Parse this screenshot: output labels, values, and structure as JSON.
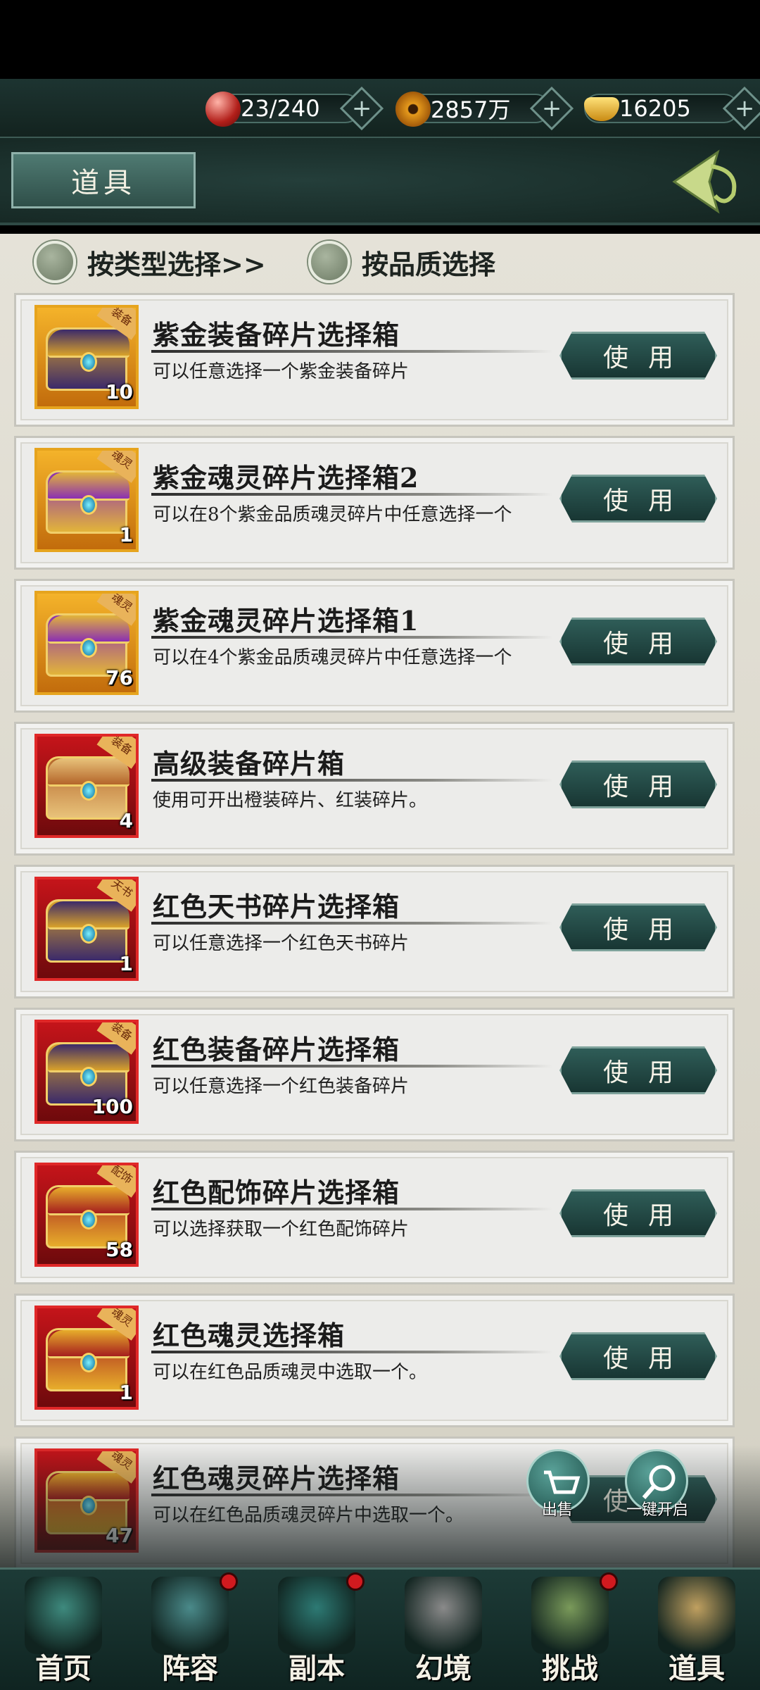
{
  "resources": [
    {
      "name": "stamina",
      "value": "23/240",
      "color": "#c0392b"
    },
    {
      "name": "coins",
      "value": "2857万",
      "color": "#d78a15"
    },
    {
      "name": "ingots",
      "value": "16205",
      "color": "#e7b325"
    }
  ],
  "header": {
    "title": "道具"
  },
  "filters": {
    "by_type": "按类型选择>>",
    "by_quality": "按品质选择"
  },
  "items": [
    {
      "name": "紫金装备碎片选择箱",
      "desc": "可以任意选择一个紫金装备碎片",
      "qty": "10",
      "frame": "gold",
      "chest": "gold",
      "tag": "装备",
      "button": "使用"
    },
    {
      "name": "紫金魂灵碎片选择箱2",
      "desc": "可以在8个紫金品质魂灵碎片中任意选择一个",
      "qty": "1",
      "frame": "gold",
      "chest": "purple",
      "tag": "魂灵",
      "button": "使用"
    },
    {
      "name": "紫金魂灵碎片选择箱1",
      "desc": "可以在4个紫金品质魂灵碎片中任意选择一个",
      "qty": "76",
      "frame": "gold",
      "chest": "purple",
      "tag": "魂灵",
      "button": "使用"
    },
    {
      "name": "高级装备碎片箱",
      "desc": "使用可开出橙装碎片、红装碎片。",
      "qty": "4",
      "frame": "red",
      "chest": "brown",
      "tag": "装备",
      "button": "使用"
    },
    {
      "name": "红色天书碎片选择箱",
      "desc": "可以任意选择一个红色天书碎片",
      "qty": "1",
      "frame": "red",
      "chest": "gold",
      "tag": "天书",
      "button": "使用"
    },
    {
      "name": "红色装备碎片选择箱",
      "desc": "可以任意选择一个红色装备碎片",
      "qty": "100",
      "frame": "red",
      "chest": "gold",
      "tag": "装备",
      "button": "使用"
    },
    {
      "name": "红色配饰碎片选择箱",
      "desc": "可以选择获取一个红色配饰碎片",
      "qty": "58",
      "frame": "red",
      "chest": "red",
      "tag": "配饰",
      "button": "使用"
    },
    {
      "name": "红色魂灵选择箱",
      "desc": "可以在红色品质魂灵中选取一个。",
      "qty": "1",
      "frame": "red",
      "chest": "red",
      "tag": "魂灵",
      "button": "使用"
    },
    {
      "name": "红色魂灵碎片选择箱",
      "desc": "可以在红色品质魂灵碎片中选取一个。",
      "qty": "47",
      "frame": "red",
      "chest": "red",
      "tag": "魂灵",
      "button": "使用"
    }
  ],
  "floating": {
    "sell": "出售",
    "open_all": "一键开启"
  },
  "nav": [
    {
      "label": "首页",
      "badge": false,
      "icon": "home-icon"
    },
    {
      "label": "阵容",
      "badge": true,
      "icon": "lineup-icon"
    },
    {
      "label": "副本",
      "badge": true,
      "icon": "dungeon-icon"
    },
    {
      "label": "幻境",
      "badge": false,
      "icon": "illusion-icon"
    },
    {
      "label": "挑战",
      "badge": true,
      "icon": "challenge-icon"
    },
    {
      "label": "道具",
      "badge": false,
      "icon": "bag-icon"
    }
  ]
}
